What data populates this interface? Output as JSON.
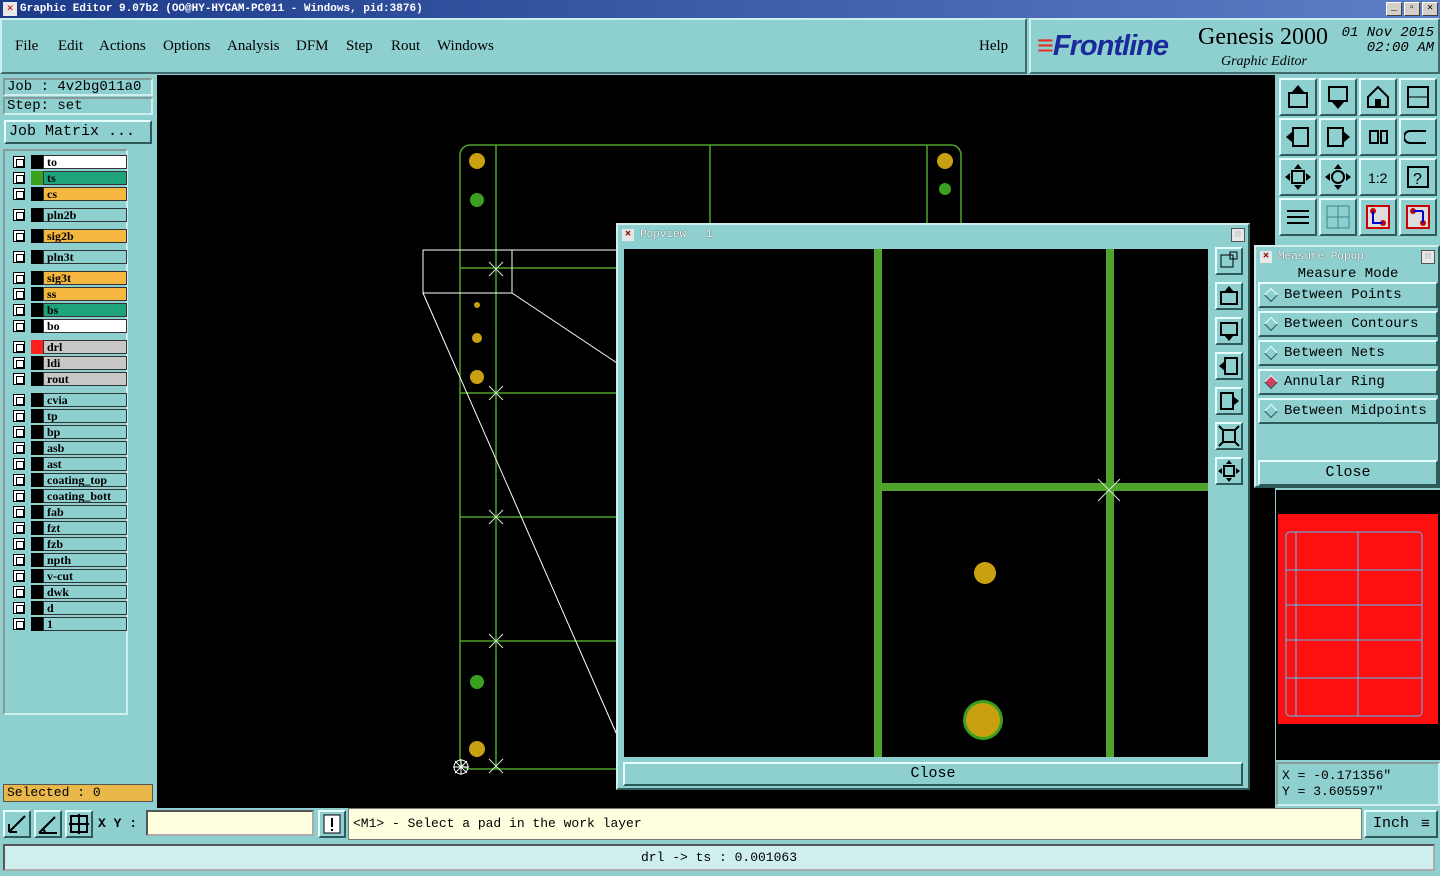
{
  "window": {
    "title": "Graphic Editor 9.07b2 (OO@HY-HYCAM-PC011 - Windows, pid:3876)"
  },
  "menu": {
    "items": [
      "File",
      "Edit",
      "Actions",
      "Options",
      "Analysis",
      "DFM",
      "Step",
      "Rout",
      "Windows"
    ],
    "help": "Help"
  },
  "brand": {
    "logo_prefix": "F",
    "logo_rest": "rontline",
    "product": "Genesis 2000",
    "subtitle": "Graphic Editor",
    "date": "01 Nov 2015",
    "time": "02:00 AM"
  },
  "job": {
    "job_label": "Job : 4v2bg011a0",
    "step_label": "Step: set",
    "matrix_button": "Job Matrix ..."
  },
  "layers": [
    {
      "name": "to",
      "color": "#ffffff",
      "swatch": "#000000"
    },
    {
      "name": "ts",
      "color": "#1fa37a",
      "swatch": "#3aa020"
    },
    {
      "name": "cs",
      "color": "#f5b740",
      "swatch": "#000000"
    },
    {
      "name": "pln2b",
      "color": "#8ecfcf",
      "swatch": "#000000"
    },
    {
      "name": "sig2b",
      "color": "#f5b740",
      "swatch": "#000000"
    },
    {
      "name": "pln3t",
      "color": "#8ecfcf",
      "swatch": "#000000"
    },
    {
      "name": "sig3t",
      "color": "#f5b740",
      "swatch": "#000000"
    },
    {
      "name": "ss",
      "color": "#f5b740",
      "swatch": "#000000"
    },
    {
      "name": "bs",
      "color": "#1fa37a",
      "swatch": "#000000"
    },
    {
      "name": "bo",
      "color": "#ffffff",
      "swatch": "#000000"
    },
    {
      "name": "drl",
      "color": "#c8c8c8",
      "swatch": "#ff2020"
    },
    {
      "name": "ldi",
      "color": "#c8c8c8",
      "swatch": "#000000"
    },
    {
      "name": "rout",
      "color": "#c8c8c8",
      "swatch": "#000000"
    },
    {
      "name": "cvia",
      "color": "#8ecfcf",
      "swatch": "#000000"
    },
    {
      "name": "tp",
      "color": "#8ecfcf",
      "swatch": "#000000"
    },
    {
      "name": "bp",
      "color": "#8ecfcf",
      "swatch": "#000000"
    },
    {
      "name": "asb",
      "color": "#8ecfcf",
      "swatch": "#000000"
    },
    {
      "name": "ast",
      "color": "#8ecfcf",
      "swatch": "#000000"
    },
    {
      "name": "coating_top",
      "color": "#8ecfcf",
      "swatch": "#000000"
    },
    {
      "name": "coating_bott",
      "color": "#8ecfcf",
      "swatch": "#000000"
    },
    {
      "name": "fab",
      "color": "#8ecfcf",
      "swatch": "#000000"
    },
    {
      "name": "fzt",
      "color": "#8ecfcf",
      "swatch": "#000000"
    },
    {
      "name": "fzb",
      "color": "#8ecfcf",
      "swatch": "#000000"
    },
    {
      "name": "npth",
      "color": "#8ecfcf",
      "swatch": "#000000"
    },
    {
      "name": "v-cut",
      "color": "#8ecfcf",
      "swatch": "#000000"
    },
    {
      "name": "dwk",
      "color": "#8ecfcf",
      "swatch": "#000000"
    },
    {
      "name": "d",
      "color": "#8ecfcf",
      "swatch": "#000000"
    },
    {
      "name": "1",
      "color": "#8ecfcf",
      "swatch": "#000000"
    }
  ],
  "selected": "Selected : 0",
  "popview": {
    "title": "Popview - 1",
    "close": "Close"
  },
  "measure": {
    "title": "Measure Popup",
    "header": "Measure Mode",
    "options": [
      {
        "label": "Between Points",
        "selected": false
      },
      {
        "label": "Between Contours",
        "selected": false
      },
      {
        "label": "Between Nets",
        "selected": false
      },
      {
        "label": "Annular Ring",
        "selected": true
      },
      {
        "label": "Between Midpoints",
        "selected": false
      }
    ],
    "close": "Close"
  },
  "coords": {
    "x": "X = -0.171356\"",
    "y": "Y = 3.605597\""
  },
  "statusbar": {
    "xy_label": "X Y :",
    "xy_value": "",
    "message": "<M1> - Select a pad in the work layer",
    "unit": "Inch"
  },
  "result": "drl -> ts : 0.001063",
  "colors": {
    "panel": "#8ecfcf",
    "pad": "#c8a010",
    "trace": "#4fa32a",
    "overview_fill": "#ff1010"
  }
}
